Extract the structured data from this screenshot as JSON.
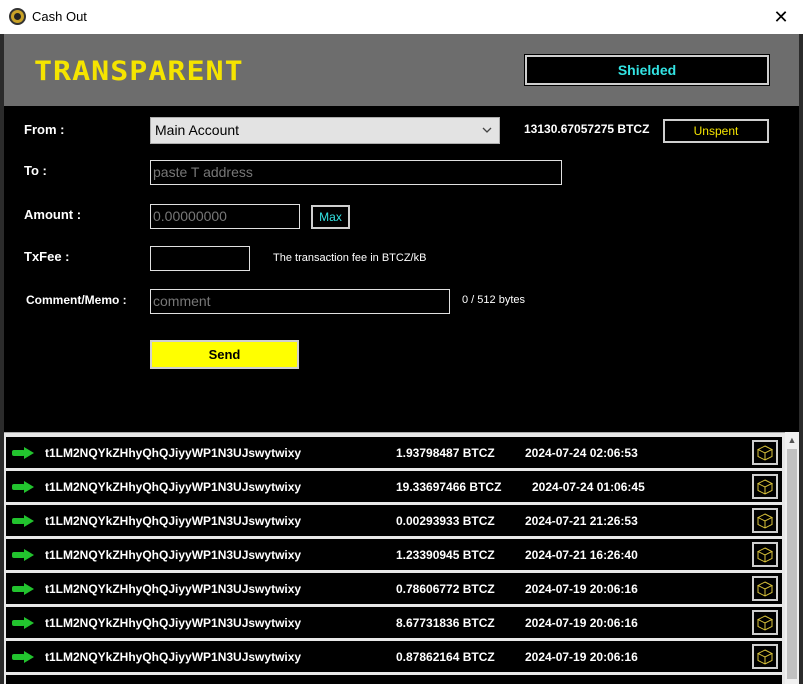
{
  "window": {
    "title": "Cash Out",
    "close_glyph": "✕"
  },
  "header": {
    "logo_text": "TRANSPARENT",
    "shielded_label": "Shielded"
  },
  "form": {
    "from_label": "From :",
    "from_value": "Main Account",
    "balance": "13130.67057275 BTCZ",
    "unspent_label": "Unspent",
    "to_label": "To :",
    "to_placeholder": "paste T address",
    "amount_label": "Amount :",
    "amount_placeholder": "0.00000000",
    "max_label": "Max",
    "txfee_label": "TxFee :",
    "txfee_value": "",
    "txfee_hint": "The transaction fee in BTCZ/kB",
    "memo_label": "Comment/Memo :",
    "memo_placeholder": "comment",
    "memo_counter": "0 / 512 bytes",
    "send_label": "Send"
  },
  "transactions": [
    {
      "address": "t1LM2NQYkZHhyQhQJiyyWP1N3UJswytwixy",
      "amount": "1.93798487 BTCZ",
      "date": "2024-07-24 02:06:53"
    },
    {
      "address": "t1LM2NQYkZHhyQhQJiyyWP1N3UJswytwixy",
      "amount": "19.33697466 BTCZ",
      "date": "2024-07-24 01:06:45"
    },
    {
      "address": "t1LM2NQYkZHhyQhQJiyyWP1N3UJswytwixy",
      "amount": "0.00293933 BTCZ",
      "date": "2024-07-21 21:26:53"
    },
    {
      "address": "t1LM2NQYkZHhyQhQJiyyWP1N3UJswytwixy",
      "amount": "1.23390945 BTCZ",
      "date": "2024-07-21 16:26:40"
    },
    {
      "address": "t1LM2NQYkZHhyQhQJiyyWP1N3UJswytwixy",
      "amount": "0.78606772 BTCZ",
      "date": "2024-07-19 20:06:16"
    },
    {
      "address": "t1LM2NQYkZHhyQhQJiyyWP1N3UJswytwixy",
      "amount": "8.67731836 BTCZ",
      "date": "2024-07-19 20:06:16"
    },
    {
      "address": "t1LM2NQYkZHhyQhQJiyyWP1N3UJswytwixy",
      "amount": "0.87862164 BTCZ",
      "date": "2024-07-19 20:06:16"
    }
  ],
  "colors": {
    "accent_yellow": "#f5e400",
    "accent_cyan": "#33e3e3",
    "arrow_green": "#22c32e",
    "header_gray": "#6d6d6d"
  },
  "icons": {
    "row_arrow": "green-right-arrow-icon",
    "row_action": "cube-icon"
  }
}
